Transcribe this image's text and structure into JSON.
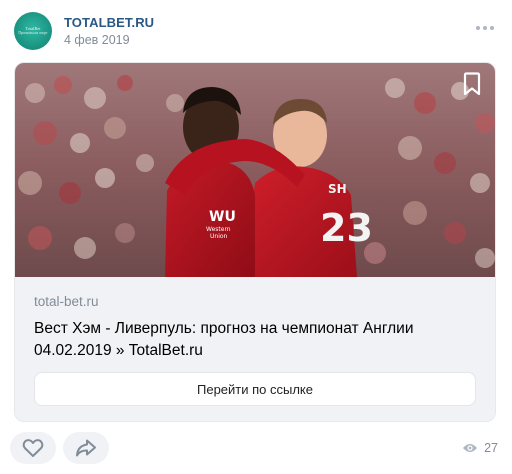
{
  "post": {
    "author": "TOTALBET.RU",
    "date": "4 фев 2019",
    "avatar": {
      "line1": "TotalBet",
      "line2": "Прогнозы на спорт"
    },
    "more_icon": "more-horizontal-icon"
  },
  "attachment": {
    "domain": "total-bet.ru",
    "title": "Вест Хэм - Ливерпуль: прогноз на чемпионат Англии 04.02.2019 » TotalBet.ru",
    "button_label": "Перейти по ссылке",
    "bookmark_icon": "bookmark-icon",
    "photo": {
      "jersey_number": "23",
      "jersey_name_fragment": "SH",
      "sponsor_logo": "WU",
      "sponsor_text_1": "Western",
      "sponsor_text_2": "Union"
    }
  },
  "footer": {
    "like_icon": "heart-icon",
    "share_icon": "share-icon",
    "views_icon": "eye-icon",
    "views": "27"
  },
  "colors": {
    "author": "#2a5885",
    "muted": "#818c99",
    "card_bg": "#f0f2f5",
    "jersey_red": "#b7121f",
    "avatar_teal": "#19917f"
  }
}
